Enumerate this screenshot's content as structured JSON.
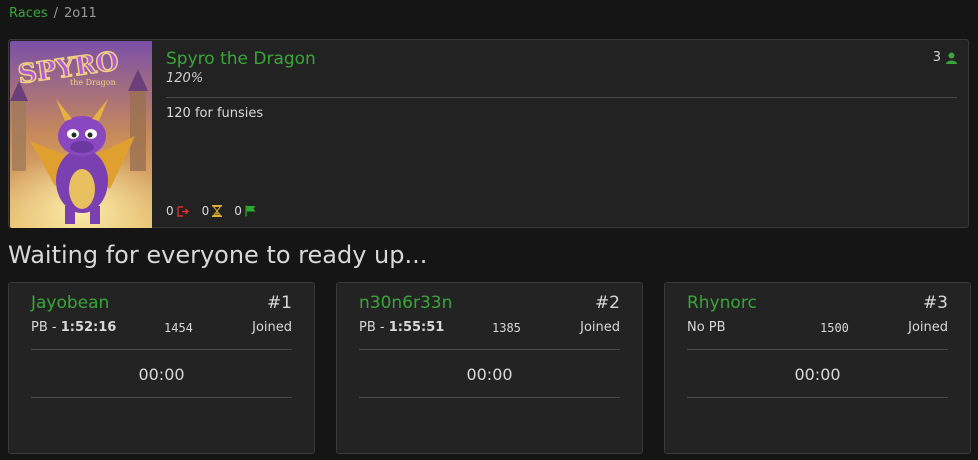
{
  "breadcrumb": {
    "root": "Races",
    "separator": "/",
    "current": "2o11"
  },
  "race": {
    "game": "Spyro the Dragon",
    "category": "120%",
    "description": "120 for funsies",
    "entrant_count": "3",
    "cover_logo_text": "SPYRO",
    "cover_logo_subtext": "the Dragon",
    "stats": {
      "forfeit": "0",
      "in_progress": "0",
      "finished": "0"
    }
  },
  "status_heading": "Waiting for everyone to ready up...",
  "entrants": [
    {
      "name": "Jayobean",
      "place": "#1",
      "pb_prefix": "PB - ",
      "pb_time": "1:52:16",
      "rating": "1454",
      "status": "Joined",
      "timer": "00:00"
    },
    {
      "name": "n30n6r33n",
      "place": "#2",
      "pb_prefix": "PB - ",
      "pb_time": "1:55:51",
      "rating": "1385",
      "status": "Joined",
      "timer": "00:00"
    },
    {
      "name": "Rhynorc",
      "place": "#3",
      "pb_prefix": "No PB",
      "pb_time": "",
      "rating": "1500",
      "status": "Joined",
      "timer": "00:00"
    }
  ],
  "colors": {
    "accent": "#3aa63a",
    "forfeit": "#d9302b",
    "hourglass": "#e0b030",
    "flag": "#2ea82e"
  }
}
